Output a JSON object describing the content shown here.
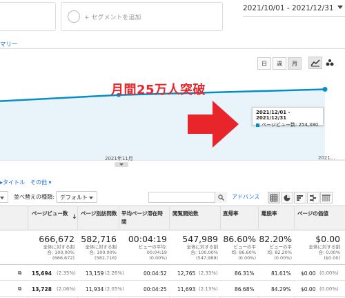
{
  "segment": {
    "add_label": "+ セグメントを追加"
  },
  "date_range": "2021/10/01 - 2021/12/31",
  "summary_tab": "マリー",
  "period_buttons": [
    "日",
    "週",
    "月"
  ],
  "annotation": "月間25万人突破",
  "tooltip": {
    "date": "2021/12/01 - 2021/12/31",
    "label": "ページビュー数: 254,380"
  },
  "chart_data": {
    "type": "area",
    "x": [
      "2021/10",
      "2021/11",
      "2021/12"
    ],
    "series": [
      {
        "name": "ページビュー数",
        "values": [
          245000,
          250000,
          254380
        ]
      }
    ],
    "x_tick_labels": [
      "2021年11月",
      "2021..."
    ],
    "color": "#058dc7",
    "fill": "#e8f3fa"
  },
  "controls": {
    "title_link": "タイトル",
    "other_link": "その他",
    "sort_label": "並べ替えの種類:",
    "sort_value": "デフォルト",
    "advanced": "アドバンス"
  },
  "columns": [
    "ページビュー数",
    "ページ別訪問数",
    "平均ページ滞在時間",
    "閲覧開始数",
    "直帰率",
    "離脱率",
    "ページの価値"
  ],
  "totals": [
    {
      "value": "666,672",
      "sub1": "全体に対する割",
      "sub2": "合: 100.00%",
      "sub3": "(666,672)"
    },
    {
      "value": "582,716",
      "sub1": "全体に対する割",
      "sub2": "合: 100.00%",
      "sub3": "(582,716)"
    },
    {
      "value": "00:04:19",
      "sub1": "ビューの平均:",
      "sub2": "00:04:19",
      "sub3": "(0.00%)"
    },
    {
      "value": "547,989",
      "sub1": "全体に対する割",
      "sub2": "合: 100.00%",
      "sub3": "(547,989)"
    },
    {
      "value": "86.60%",
      "sub1": "ビューの平",
      "sub2": "均: 86.60%",
      "sub3": "(0.00%)"
    },
    {
      "value": "82.20%",
      "sub1": "ビューの平",
      "sub2": "均: 82.20%",
      "sub3": "(0.00%)"
    },
    {
      "value": "$0.00",
      "sub1": "全体に対する割",
      "sub2": "合: 0.00%",
      "sub3": "($0.00)"
    }
  ],
  "rows": [
    {
      "pv": "15,694",
      "pv_pct": "(2.35%)",
      "visits": "13,159",
      "visits_pct": "(2.26%)",
      "time": "00:04:52",
      "entr": "12,765",
      "entr_pct": "(2.33%)",
      "bounce": "86.31%",
      "exit": "81.61%",
      "value": "$0.00",
      "value_pct": "(0.00%)"
    },
    {
      "pv": "13,728",
      "pv_pct": "(2.06%)",
      "visits": "11,934",
      "visits_pct": "(2.05%)",
      "time": "00:04:25",
      "entr": "11,693",
      "entr_pct": "(2.13%)",
      "bounce": "86.68%",
      "exit": "84.29%",
      "value": "$0.00",
      "value_pct": "(0.00%)"
    }
  ]
}
